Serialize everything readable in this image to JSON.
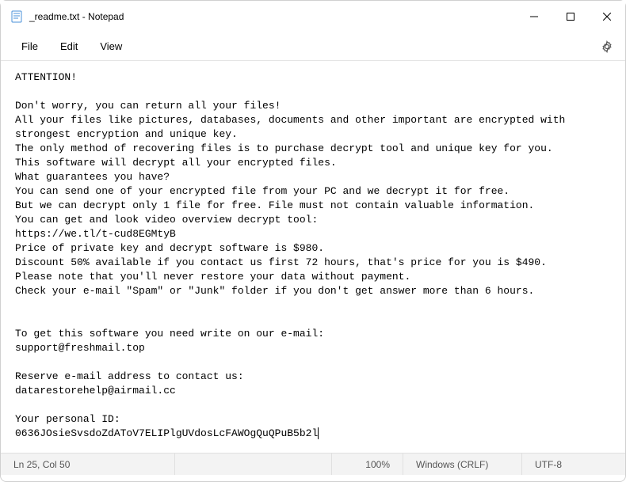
{
  "window": {
    "title": "_readme.txt - Notepad"
  },
  "menu": {
    "file": "File",
    "edit": "Edit",
    "view": "View"
  },
  "body": {
    "lines": [
      "ATTENTION!",
      "",
      "Don't worry, you can return all your files!",
      "All your files like pictures, databases, documents and other important are encrypted with",
      "strongest encryption and unique key.",
      "The only method of recovering files is to purchase decrypt tool and unique key for you.",
      "This software will decrypt all your encrypted files.",
      "What guarantees you have?",
      "You can send one of your encrypted file from your PC and we decrypt it for free.",
      "But we can decrypt only 1 file for free. File must not contain valuable information.",
      "You can get and look video overview decrypt tool:",
      "https://we.tl/t-cud8EGMtyB",
      "Price of private key and decrypt software is $980.",
      "Discount 50% available if you contact us first 72 hours, that's price for you is $490.",
      "Please note that you'll never restore your data without payment.",
      "Check your e-mail \"Spam\" or \"Junk\" folder if you don't get answer more than 6 hours.",
      "",
      "",
      "To get this software you need write on our e-mail:",
      "support@freshmail.top",
      "",
      "Reserve e-mail address to contact us:",
      "datarestorehelp@airmail.cc",
      "",
      "Your personal ID:",
      "0636JOsieSvsdoZdAToV7ELIPlgUVdosLcFAWOgQuQPuB5b2l"
    ]
  },
  "status": {
    "position": "Ln 25, Col 50",
    "zoom": "100%",
    "eol": "Windows (CRLF)",
    "encoding": "UTF-8"
  }
}
